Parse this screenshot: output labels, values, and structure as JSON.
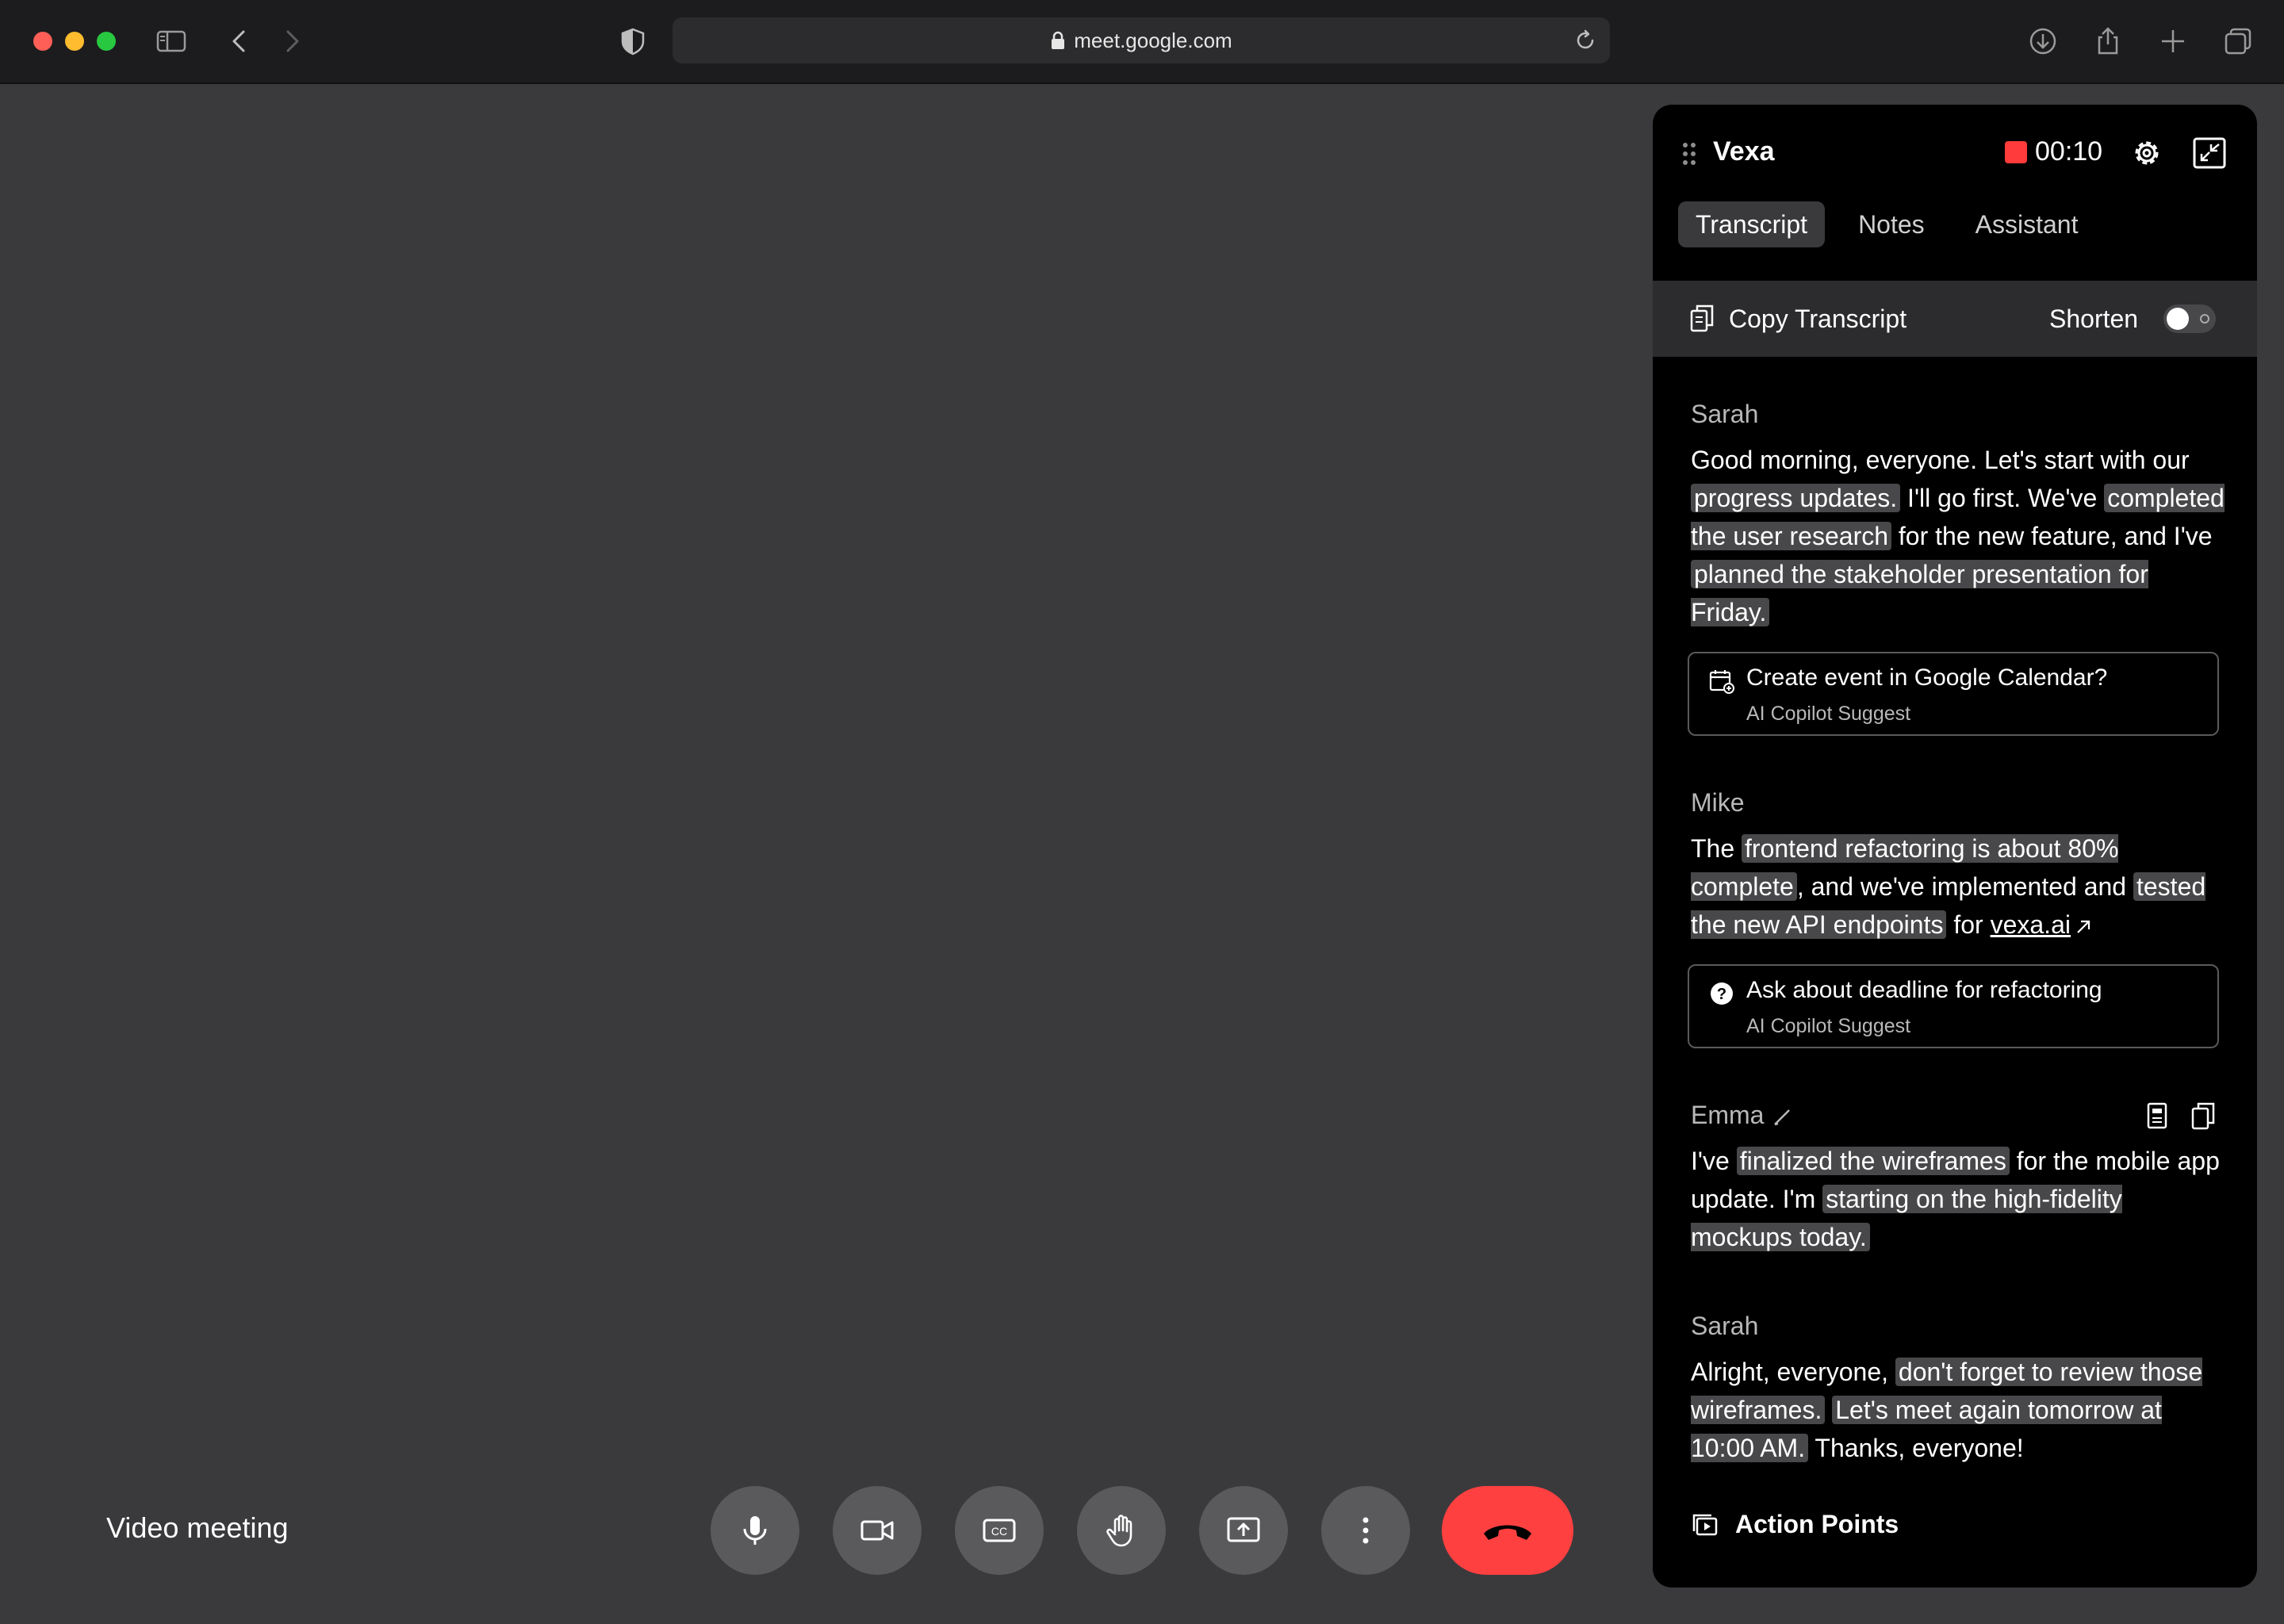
{
  "browser": {
    "url": "meet.google.com"
  },
  "meeting": {
    "title": "Video meeting",
    "controls": [
      "microphone",
      "camera",
      "captions",
      "raise-hand",
      "present",
      "more-options",
      "end-call"
    ]
  },
  "panel": {
    "brand": "Vexa",
    "timer": "00:10",
    "tabs": {
      "transcript": "Transcript",
      "notes": "Notes",
      "assistant": "Assistant"
    },
    "active_tab": "Transcript",
    "toolbar": {
      "copy_label": "Copy Transcript",
      "shorten_label": "Shorten",
      "shorten_on": false
    },
    "transcript": [
      {
        "speaker": "Sarah",
        "segments": [
          {
            "t": "Good morning, everyone. Let's start with our "
          },
          {
            "t": "progress updates.",
            "hl": true
          },
          {
            "t": " I'll go first. We've "
          },
          {
            "t": "completed the user research",
            "hl": true
          },
          {
            "t": " for the new feature, and I've "
          },
          {
            "t": "planned the stakeholder presentation for Friday.",
            "hl": true
          }
        ]
      },
      {
        "speaker": "Mike",
        "segments": [
          {
            "t": "The "
          },
          {
            "t": "frontend refactoring is about 80% complete",
            "hl": true
          },
          {
            "t": ", and we've implemented and "
          },
          {
            "t": "tested the new API endpoints",
            "hl": true
          },
          {
            "t": " for "
          },
          {
            "t": "vexa.ai",
            "link": true
          }
        ]
      },
      {
        "speaker": "Emma",
        "segments": [
          {
            "t": "I've "
          },
          {
            "t": "finalized the wireframes",
            "hl": true
          },
          {
            "t": " for the mobile app update. I'm "
          },
          {
            "t": "starting on the high-fidelity mockups today.",
            "hl": true
          }
        ]
      },
      {
        "speaker": "Sarah",
        "segments": [
          {
            "t": "Alright, everyone, "
          },
          {
            "t": "don't forget to review those wireframes.",
            "hl": true
          },
          {
            "t": " "
          },
          {
            "t": "Let's meet again tomorrow at 10:00 AM.",
            "hl": true
          },
          {
            "t": " Thanks, everyone!"
          }
        ]
      }
    ],
    "suggestions": [
      {
        "title": "Create event in Google Calendar?",
        "subtitle": "AI Copilot Suggest",
        "icon": "calendar-icon"
      },
      {
        "title": "Ask about deadline for refactoring",
        "subtitle": "AI Copilot Suggest",
        "icon": "question-icon"
      }
    ],
    "action_points_label": "Action Points"
  },
  "colors": {
    "stage_bg": "#3a3a3c",
    "panel_bg": "#000000",
    "highlight": "#48484a",
    "record": "#ff3b3b",
    "end_call": "#ff4040"
  }
}
